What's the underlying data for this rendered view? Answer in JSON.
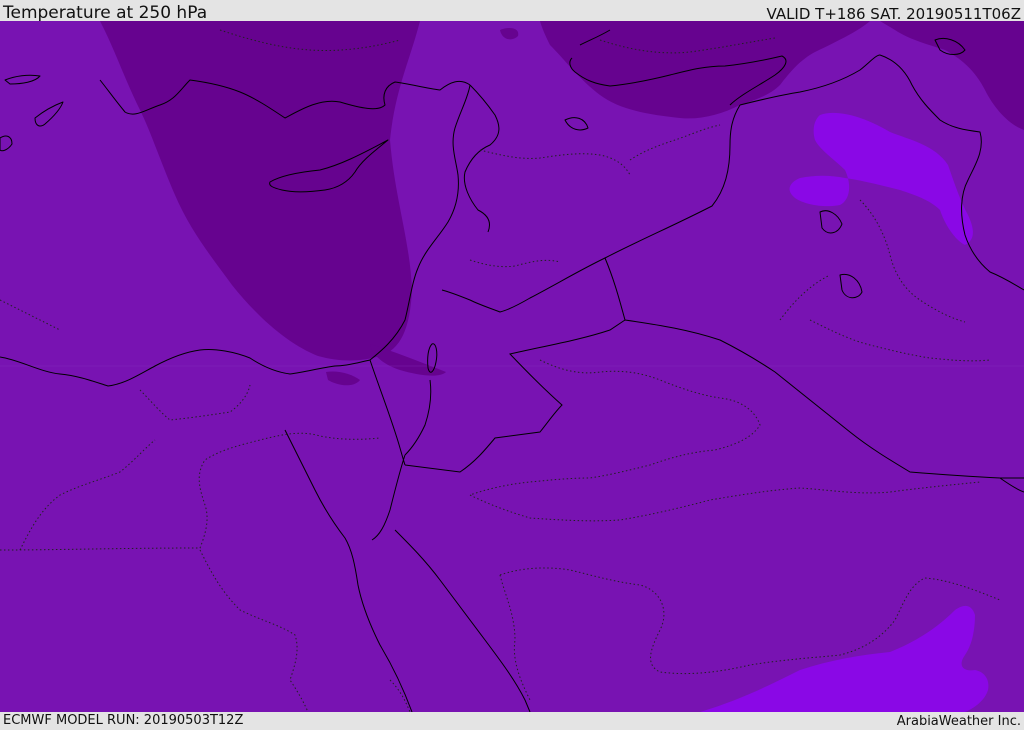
{
  "header": {
    "title": "Temperature at 250 hPa",
    "valid": "VALID T+186 SAT. 20190511T06Z"
  },
  "footer": {
    "model_run": "ECMWF MODEL RUN: 20190503T12Z",
    "credit": "ArabiaWeather Inc."
  },
  "map": {
    "base_color": "#7813b2",
    "colors": {
      "band_dark": "#66038f",
      "band_mid": "#7913b4",
      "band_light": "#8a08e6",
      "coast_line": "#000000",
      "border_line": "#000000"
    },
    "layers": [
      "temperature-fill",
      "coastlines",
      "country-borders",
      "admin-boundaries"
    ]
  }
}
